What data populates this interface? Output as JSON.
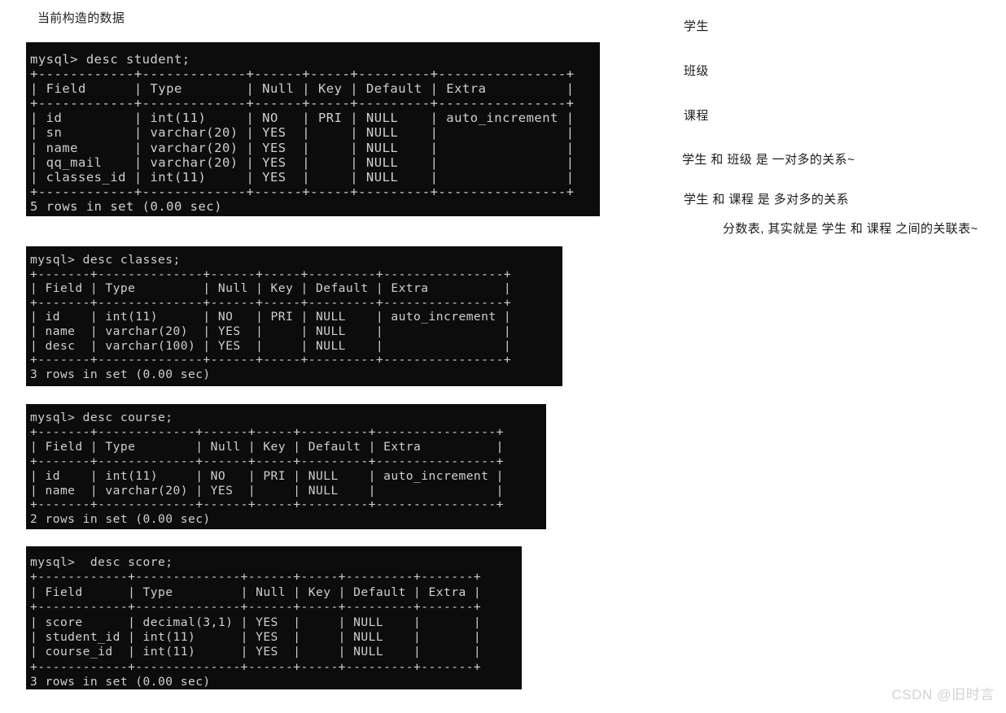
{
  "page": {
    "title": "当前构造的数据",
    "watermark": "CSDN @旧时言"
  },
  "terminals": [
    {
      "name": "student",
      "command": "mysql> desc student;",
      "rows_summary": "5 rows in set (0.00 sec)",
      "columns": [
        "Field",
        "Type",
        "Null",
        "Key",
        "Default",
        "Extra"
      ],
      "rows": [
        {
          "Field": "id",
          "Type": "int(11)",
          "Null": "NO",
          "Key": "PRI",
          "Default": "NULL",
          "Extra": "auto_increment"
        },
        {
          "Field": "sn",
          "Type": "varchar(20)",
          "Null": "YES",
          "Key": "",
          "Default": "NULL",
          "Extra": ""
        },
        {
          "Field": "name",
          "Type": "varchar(20)",
          "Null": "YES",
          "Key": "",
          "Default": "NULL",
          "Extra": ""
        },
        {
          "Field": "qq_mail",
          "Type": "varchar(20)",
          "Null": "YES",
          "Key": "",
          "Default": "NULL",
          "Extra": ""
        },
        {
          "Field": "classes_id",
          "Type": "int(11)",
          "Null": "YES",
          "Key": "",
          "Default": "NULL",
          "Extra": ""
        }
      ],
      "text": "mysql> desc student;\n+------------+-------------+------+-----+---------+----------------+\n| Field      | Type        | Null | Key | Default | Extra          |\n+------------+-------------+------+-----+---------+----------------+\n| id         | int(11)     | NO   | PRI | NULL    | auto_increment |\n| sn         | varchar(20) | YES  |     | NULL    |                |\n| name       | varchar(20) | YES  |     | NULL    |                |\n| qq_mail    | varchar(20) | YES  |     | NULL    |                |\n| classes_id | int(11)     | YES  |     | NULL    |                |\n+------------+-------------+------+-----+---------+----------------+\n5 rows in set (0.00 sec)"
    },
    {
      "name": "classes",
      "command": "mysql> desc classes;",
      "rows_summary": "3 rows in set (0.00 sec)",
      "columns": [
        "Field",
        "Type",
        "Null",
        "Key",
        "Default",
        "Extra"
      ],
      "rows": [
        {
          "Field": "id",
          "Type": "int(11)",
          "Null": "NO",
          "Key": "PRI",
          "Default": "NULL",
          "Extra": "auto_increment"
        },
        {
          "Field": "name",
          "Type": "varchar(20)",
          "Null": "YES",
          "Key": "",
          "Default": "NULL",
          "Extra": ""
        },
        {
          "Field": "desc",
          "Type": "varchar(100)",
          "Null": "YES",
          "Key": "",
          "Default": "NULL",
          "Extra": ""
        }
      ],
      "text": "mysql> desc classes;\n+-------+--------------+------+-----+---------+----------------+\n| Field | Type         | Null | Key | Default | Extra          |\n+-------+--------------+------+-----+---------+----------------+\n| id    | int(11)      | NO   | PRI | NULL    | auto_increment |\n| name  | varchar(20)  | YES  |     | NULL    |                |\n| desc  | varchar(100) | YES  |     | NULL    |                |\n+-------+--------------+------+-----+---------+----------------+\n3 rows in set (0.00 sec)"
    },
    {
      "name": "course",
      "command": "mysql> desc course;",
      "rows_summary": "2 rows in set (0.00 sec)",
      "columns": [
        "Field",
        "Type",
        "Null",
        "Key",
        "Default",
        "Extra"
      ],
      "rows": [
        {
          "Field": "id",
          "Type": "int(11)",
          "Null": "NO",
          "Key": "PRI",
          "Default": "NULL",
          "Extra": "auto_increment"
        },
        {
          "Field": "name",
          "Type": "varchar(20)",
          "Null": "YES",
          "Key": "",
          "Default": "NULL",
          "Extra": ""
        }
      ],
      "text": "mysql> desc course;\n+-------+-------------+------+-----+---------+----------------+\n| Field | Type        | Null | Key | Default | Extra          |\n+-------+-------------+------+-----+---------+----------------+\n| id    | int(11)     | NO   | PRI | NULL    | auto_increment |\n| name  | varchar(20) | YES  |     | NULL    |                |\n+-------+-------------+------+-----+---------+----------------+\n2 rows in set (0.00 sec)"
    },
    {
      "name": "score",
      "command": "mysql>  desc score;",
      "rows_summary": "3 rows in set (0.00 sec)",
      "columns": [
        "Field",
        "Type",
        "Null",
        "Key",
        "Default",
        "Extra"
      ],
      "rows": [
        {
          "Field": "score",
          "Type": "decimal(3,1)",
          "Null": "YES",
          "Key": "",
          "Default": "NULL",
          "Extra": ""
        },
        {
          "Field": "student_id",
          "Type": "int(11)",
          "Null": "YES",
          "Key": "",
          "Default": "NULL",
          "Extra": ""
        },
        {
          "Field": "course_id",
          "Type": "int(11)",
          "Null": "YES",
          "Key": "",
          "Default": "NULL",
          "Extra": ""
        }
      ],
      "text": "mysql>  desc score;\n+------------+--------------+------+-----+---------+-------+\n| Field      | Type         | Null | Key | Default | Extra |\n+------------+--------------+------+-----+---------+-------+\n| score      | decimal(3,1) | YES  |     | NULL    |       |\n| student_id | int(11)      | YES  |     | NULL    |       |\n| course_id  | int(11)      | YES  |     | NULL    |       |\n+------------+--------------+------+-----+---------+-------+\n3 rows in set (0.00 sec)"
    }
  ],
  "notes": {
    "entity_student": "学生",
    "entity_classes": "班级",
    "entity_course": "课程",
    "relation_one_to_many": "学生 和 班级 是 一对多的关系~",
    "relation_many_to_many": "学生 和 课程 是 多对多的关系",
    "relation_score_table": "分数表, 其实就是 学生 和 课程 之间的关联表~"
  }
}
